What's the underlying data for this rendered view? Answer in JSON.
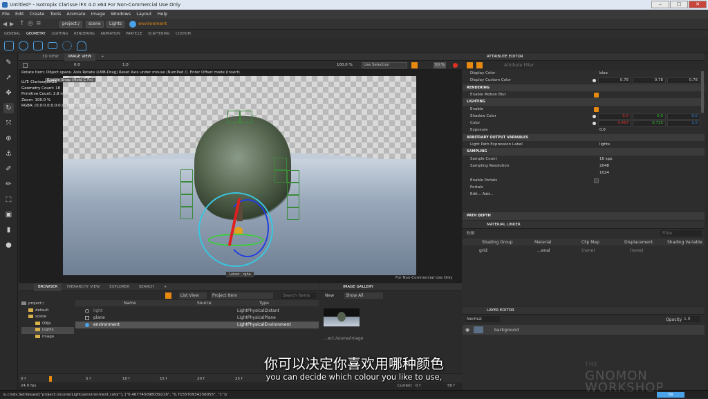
{
  "window": {
    "title": "Untitled* - Isotropix Clarisse iFX 4.0 x64  For Non-Commercial Use Only",
    "buttons": [
      "–",
      "□",
      "✕"
    ]
  },
  "menu": [
    "File",
    "Edit",
    "Create",
    "Tools",
    "Animate",
    "Image",
    "Windows",
    "Layout",
    "Help"
  ],
  "path": [
    "project:/",
    "scene",
    "Lights",
    "environment"
  ],
  "shelf_tabs": [
    "GENERAL",
    "GEOMETRY",
    "LIGHTING",
    "RENDERING",
    "ANIMATION",
    "PARTICLE",
    "SCATTERING",
    "CUSTOM"
  ],
  "shelf_active": "GEOMETRY",
  "viewport": {
    "tabs": [
      "3D VIEW",
      "IMAGE VIEW",
      "+"
    ],
    "active_tab": "IMAGE VIEW",
    "toolbar": {
      "value1": "0.0",
      "value2": "1.0",
      "zoom": "100.0 %",
      "selection": "Use Selection",
      "percent": "50 %"
    },
    "statusline": "Rotate Item: Object space. Axis Rotate (LMB-Drag) Reset Axis under mouse (NumPad /). Enter Offset mode (Insert)",
    "enable_snap": "Enable Snap (Hold C Fn)",
    "hud": [
      "LUT: ClarisseJsRGB",
      "Geometry Count: 18",
      "Primitive Count: 2.8 million",
      "Zoom: 100.0 %",
      "RGBA: [0.0:0.0:0.0:0.0]  HSB: [0.0:0.0:0.0]"
    ],
    "render_label": "Latest : rgba",
    "noncommercial": "For Non-Commercial Use Only"
  },
  "attribute_editor": {
    "title": "ATTRIBUTE EDITOR",
    "filter_placeholder": "Attribute Filter",
    "rows": [
      {
        "type": "row",
        "label": "Display Color",
        "text": "blue"
      },
      {
        "type": "row",
        "label": "Display Custom Color",
        "vals": [
          "0.78",
          "0.78",
          "0.78"
        ]
      },
      {
        "type": "section",
        "label": "RENDERING"
      },
      {
        "type": "row",
        "label": "Enable Motion Blur",
        "check": true
      },
      {
        "type": "section",
        "label": "LIGHTING"
      },
      {
        "type": "row",
        "label": "Enable",
        "check": true
      },
      {
        "type": "row",
        "label": "Shadow Color",
        "vals": [
          "0.0",
          "0.0",
          "0.0"
        ]
      },
      {
        "type": "row",
        "label": "Color",
        "vals": [
          "0.467",
          "0.715",
          "1.0"
        ]
      },
      {
        "type": "row",
        "label": "Exposure",
        "text": "0.0"
      },
      {
        "type": "section",
        "label": "ARBITRARY OUTPUT VARIABLES"
      },
      {
        "type": "row",
        "label": "Light Path Expression Label",
        "text": "lights"
      },
      {
        "type": "section",
        "label": "SAMPLING"
      },
      {
        "type": "row",
        "label": "Sample Count",
        "text": "16 spp"
      },
      {
        "type": "row",
        "label": "Sampling Resolution",
        "text": "2048"
      },
      {
        "type": "row",
        "label": "",
        "text": "1024"
      },
      {
        "type": "row",
        "label": "Enable Portals",
        "check": false
      },
      {
        "type": "row",
        "label": "Portals",
        "text": ""
      },
      {
        "type": "row",
        "label": "Edit... Add...",
        "text": ""
      },
      {
        "type": "row",
        "label": "",
        "text": ""
      },
      {
        "type": "row",
        "label": "",
        "text": ""
      },
      {
        "type": "section",
        "label": "PATH DEPTH"
      }
    ]
  },
  "material_linker": {
    "title": "MATERIAL LINKER",
    "edit": "Edit",
    "filter_placeholder": "Filter",
    "columns": [
      "Shading Group",
      "Material",
      "Clip Map",
      "Displacement",
      "Shading Variable"
    ],
    "row": [
      "grid",
      "...enal",
      "(none)",
      "(none)",
      ""
    ]
  },
  "layer_editor": {
    "title": "LAYER EDITOR",
    "blend": "Normal",
    "opacity_label": "Opacity",
    "opacity": "1.0",
    "layer": "background"
  },
  "browser": {
    "tabs": [
      "BROWSER",
      "HIERARCHY VIEW",
      "EXPLORER",
      "SEARCH",
      "+"
    ],
    "view_mode": "List View",
    "project_item": "Project Item",
    "search_placeholder": "Search Items",
    "tree": [
      "project:/",
      "default",
      "scene",
      "OBJs",
      "Lights",
      "image"
    ],
    "columns": [
      "Name",
      "Source",
      "Type"
    ],
    "rows": [
      {
        "name": "light",
        "source": "",
        "type": "LightPhysicalDistant"
      },
      {
        "name": "plane",
        "source": "",
        "type": "LightPhysicalPlane"
      },
      {
        "name": "environment",
        "source": "",
        "type": "LightPhysicalEnvironment"
      }
    ]
  },
  "gallery": {
    "title": "IMAGE GALLERY",
    "new": "New",
    "filter": "Show All",
    "thumb_label": "...ect:/scene/image"
  },
  "timeline": {
    "start": "0 f",
    "ticks": [
      "5 f",
      "10 f",
      "15 f",
      "20 f",
      "25 f"
    ],
    "fps": "24.0 fps",
    "current_label": "Current",
    "current": "0 f",
    "end": "50 f"
  },
  "statusbar": {
    "command": "ix.cmds.SetValues([\"project://scene/Lights/environment.color\"], [\"0.467745098039216\", \"0.715570934256055\", \"1\"])",
    "value": "56"
  },
  "subtitles": {
    "cn": "你可以决定你喜欢用哪种颜色",
    "en": "you can decide which colour you like to use,"
  },
  "watermark": [
    "THE",
    "GNOMON",
    "WORKSHOP"
  ],
  "colors": {
    "accent": "#e88a10",
    "icon_blue": "#4aa3e8",
    "grid_green": "#3c8a3c"
  }
}
